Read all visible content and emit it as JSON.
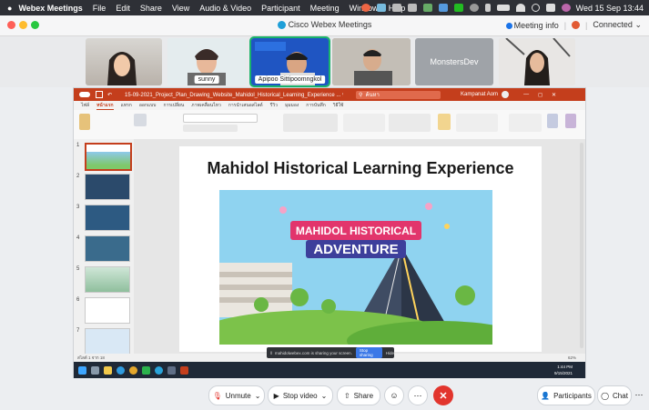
{
  "menubar": {
    "apple": "",
    "app": "Webex Meetings",
    "items": [
      "File",
      "Edit",
      "Share",
      "View",
      "Audio & Video",
      "Participant",
      "Meeting",
      "Window",
      "Help"
    ],
    "clock": "Wed 15 Sep  13:44"
  },
  "window": {
    "title": "Cisco Webex Meetings",
    "meeting_info": "Meeting info",
    "connected": "Connected"
  },
  "participants": [
    {
      "name": ""
    },
    {
      "name": "sunny"
    },
    {
      "name": "Apipoo Sittipoomngkol"
    },
    {
      "name": ""
    },
    {
      "name": "MonstersDev"
    },
    {
      "name": ""
    }
  ],
  "share": {
    "ppt_filename": "15-09-2021_Project_Plan_Drawing_Website_Mahidol_Historical_Learning_Experience ... บันทึกไปยัง พีซี ▾",
    "search": "ค้นหา",
    "ppt_user": "Kampanat Aom",
    "ribbon_tabs": [
      "ไฟล์",
      "หน้าแรก",
      "แทรก",
      "ออกแบบ",
      "การเปลี่ยน",
      "ภาพเคลื่อนไหว",
      "การนำเสนอสไลด์",
      "รีวิว",
      "มุมมอง",
      "การบันทึก",
      "วิธีใช้"
    ],
    "slide_numbers": [
      "1",
      "2",
      "3",
      "4",
      "5",
      "6",
      "7"
    ],
    "slide_title": "Mahidol Historical Learning Experience",
    "banner_line1": "MAHIDOL HISTORICAL",
    "banner_line2": "ADVENTURE",
    "share_notice": "mahidolwebex.com is sharing your screen.",
    "stop_sharing": "Stop sharing",
    "hide": "Hide",
    "status_left": "สไลด์ 1 จาก 18",
    "status_zoom": "62%",
    "taskbar_time": "1:44 PM",
    "taskbar_date": "9/15/2021"
  },
  "controls": {
    "unmute": "Unmute",
    "stop_video": "Stop video",
    "share": "Share",
    "participants": "Participants",
    "chat": "Chat"
  },
  "colors": {
    "accent": "#19b36b",
    "ppt": "#c43e1c",
    "end": "#e2352d"
  }
}
